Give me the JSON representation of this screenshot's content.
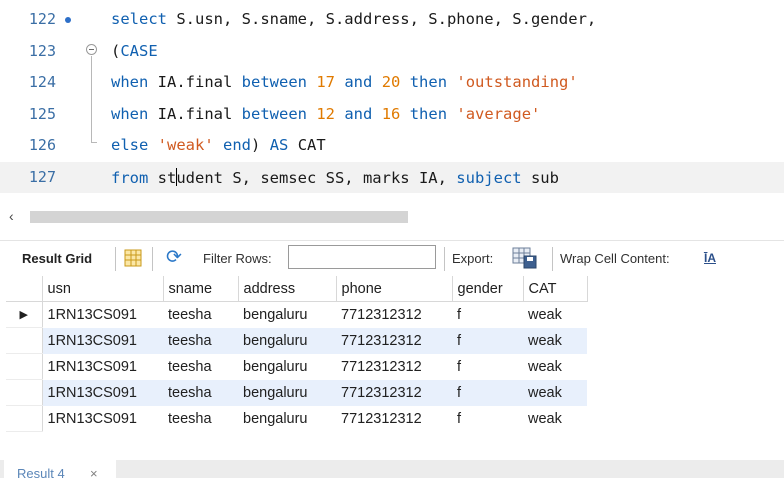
{
  "editor": {
    "lines": [
      {
        "num": "122",
        "tokens": [
          {
            "t": "select",
            "c": "kw"
          },
          {
            "t": " S.usn, S.sname, S.address, S.phone, S.gender,",
            "c": ""
          }
        ]
      },
      {
        "num": "123",
        "tokens": [
          {
            "t": "(",
            "c": ""
          },
          {
            "t": "CASE",
            "c": "kw"
          }
        ]
      },
      {
        "num": "124",
        "tokens": [
          {
            "t": "when",
            "c": "kw"
          },
          {
            "t": " IA.final ",
            "c": ""
          },
          {
            "t": "between",
            "c": "kw"
          },
          {
            "t": " ",
            "c": ""
          },
          {
            "t": "17",
            "c": "nm"
          },
          {
            "t": " ",
            "c": ""
          },
          {
            "t": "and",
            "c": "kw"
          },
          {
            "t": " ",
            "c": ""
          },
          {
            "t": "20",
            "c": "nm"
          },
          {
            "t": " ",
            "c": ""
          },
          {
            "t": "then",
            "c": "kw"
          },
          {
            "t": " ",
            "c": ""
          },
          {
            "t": "'outstanding'",
            "c": "st"
          }
        ]
      },
      {
        "num": "125",
        "tokens": [
          {
            "t": "when",
            "c": "kw"
          },
          {
            "t": " IA.final ",
            "c": ""
          },
          {
            "t": "between",
            "c": "kw"
          },
          {
            "t": " ",
            "c": ""
          },
          {
            "t": "12",
            "c": "nm"
          },
          {
            "t": " ",
            "c": ""
          },
          {
            "t": "and",
            "c": "kw"
          },
          {
            "t": " ",
            "c": ""
          },
          {
            "t": "16",
            "c": "nm"
          },
          {
            "t": " ",
            "c": ""
          },
          {
            "t": "then",
            "c": "kw"
          },
          {
            "t": " ",
            "c": ""
          },
          {
            "t": "'average'",
            "c": "st"
          }
        ]
      },
      {
        "num": "126",
        "tokens": [
          {
            "t": "else",
            "c": "kw"
          },
          {
            "t": " ",
            "c": ""
          },
          {
            "t": "'weak'",
            "c": "st"
          },
          {
            "t": " ",
            "c": ""
          },
          {
            "t": "end",
            "c": "kw"
          },
          {
            "t": ") ",
            "c": ""
          },
          {
            "t": "AS",
            "c": "kw"
          },
          {
            "t": " CAT",
            "c": ""
          }
        ]
      },
      {
        "num": "127",
        "tokens": [
          {
            "t": "from",
            "c": "kw"
          },
          {
            "t": " st",
            "c": ""
          },
          {
            "t": "|CURSOR|",
            "c": "cursor"
          },
          {
            "t": "udent S, semsec SS, marks IA, ",
            "c": ""
          },
          {
            "t": "subject",
            "c": "kw"
          },
          {
            "t": " sub",
            "c": ""
          }
        ]
      }
    ]
  },
  "toolbar": {
    "result_grid_label": "Result Grid",
    "filter_rows_label": "Filter Rows:",
    "filter_value": "",
    "export_label": "Export:",
    "wrap_label": "Wrap Cell Content:",
    "wrap_icon_text": "ĪA"
  },
  "grid": {
    "columns": [
      "usn",
      "sname",
      "address",
      "phone",
      "gender",
      "CAT"
    ],
    "rows": [
      [
        "1RN13CS091",
        "teesha",
        "bengaluru",
        "7712312312",
        "f",
        "weak"
      ],
      [
        "1RN13CS091",
        "teesha",
        "bengaluru",
        "7712312312",
        "f",
        "weak"
      ],
      [
        "1RN13CS091",
        "teesha",
        "bengaluru",
        "7712312312",
        "f",
        "weak"
      ],
      [
        "1RN13CS091",
        "teesha",
        "bengaluru",
        "7712312312",
        "f",
        "weak"
      ],
      [
        "1RN13CS091",
        "teesha",
        "bengaluru",
        "7712312312",
        "f",
        "weak"
      ]
    ],
    "current_row_marker": "▶"
  },
  "result_tab": {
    "label": "Result 4",
    "close": "×"
  },
  "icons": {
    "breakpoint": "breakpoint-dot-icon",
    "fold": "fold-minus-icon",
    "scroll_left": "‹",
    "grid": "grid-layout-icon",
    "refresh": "⟳",
    "export": "export-icon"
  },
  "colors": {
    "keyword": "#1060b0",
    "number": "#e07a00",
    "string": "#d05a20",
    "line_number": "#3a6ea5",
    "alt_row": "#e8f0fc"
  }
}
